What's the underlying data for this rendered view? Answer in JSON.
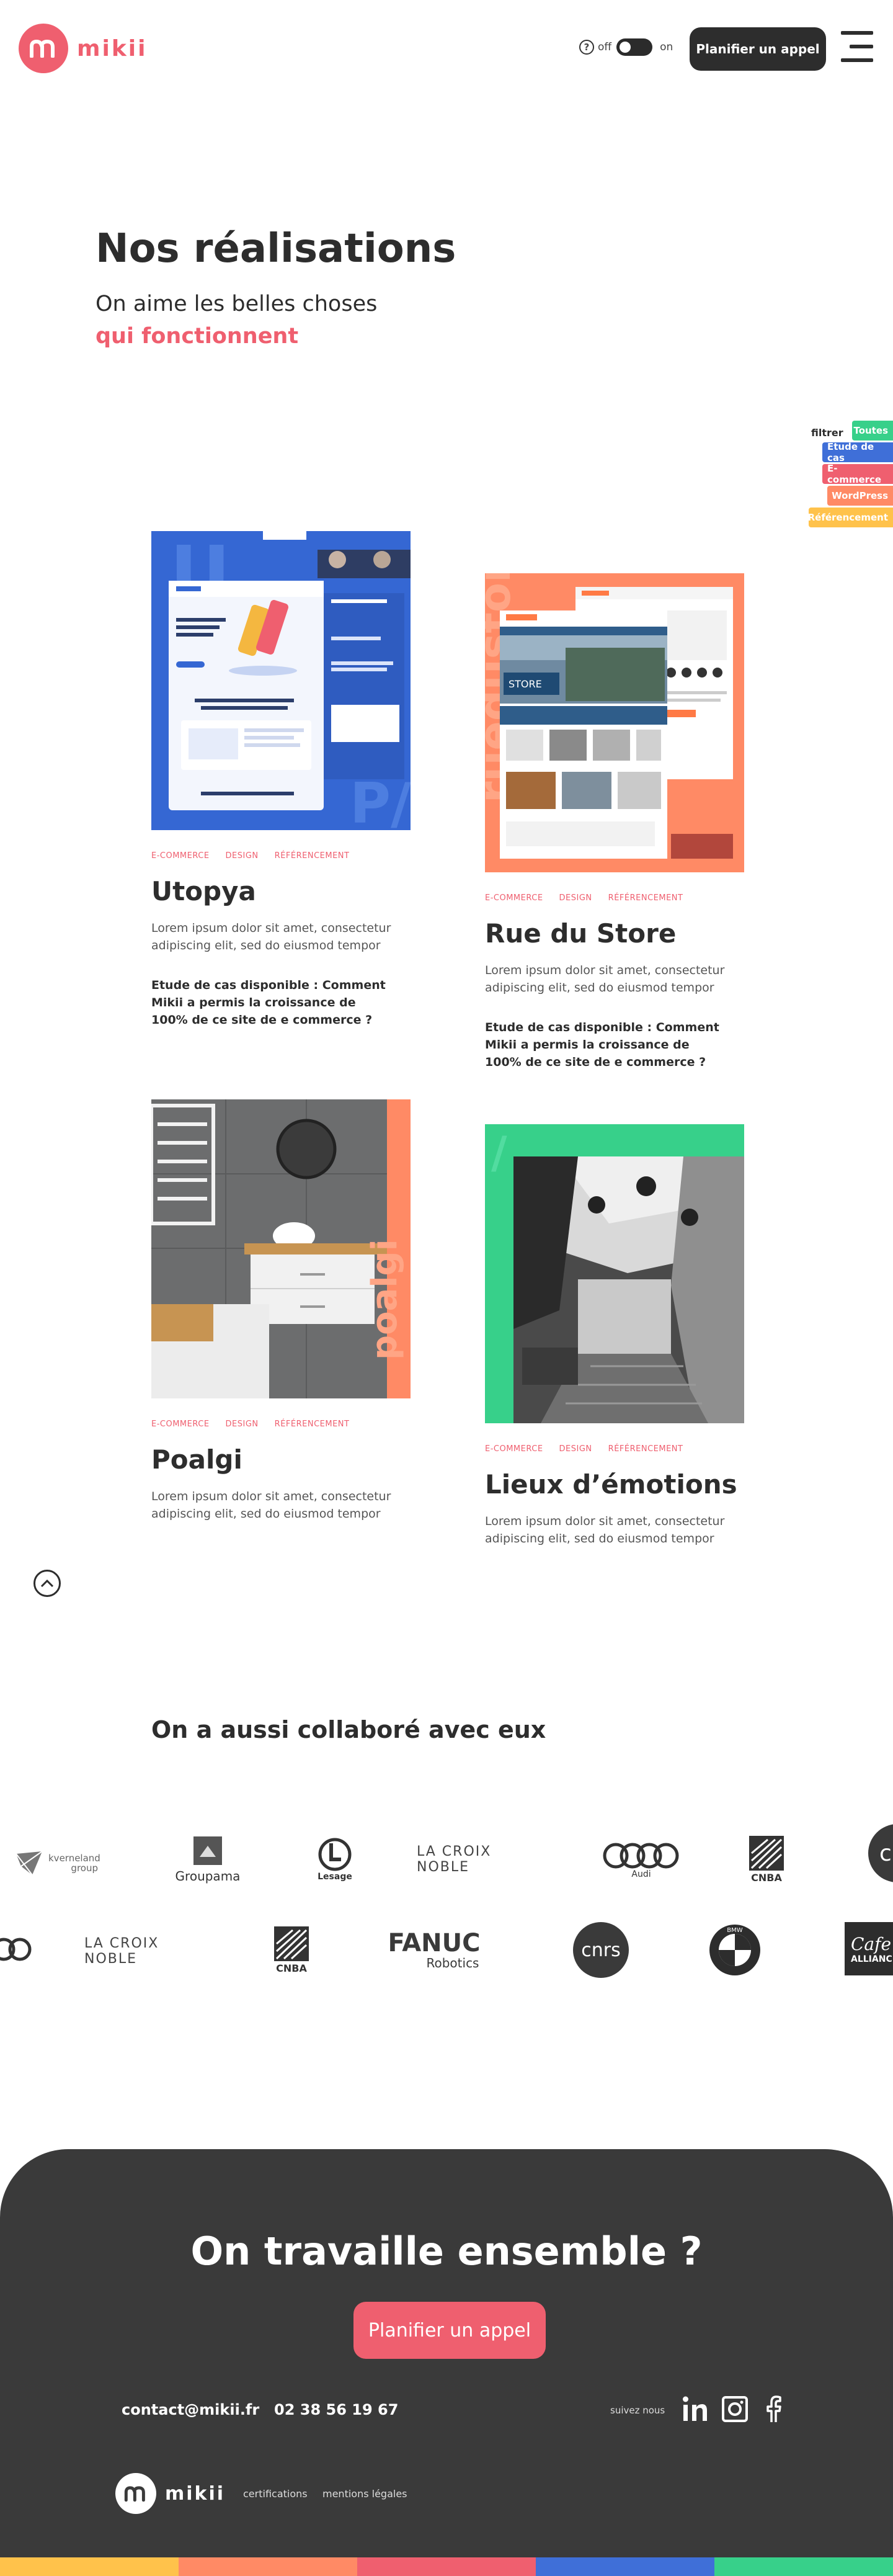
{
  "header": {
    "logo_text": "mikii",
    "toggle_off": "off",
    "toggle_on": "on",
    "cta_label": "Planifier un appel"
  },
  "intro": {
    "title": "Nos réalisations",
    "subtitle_line1": "On aime les belles choses",
    "subtitle_line2": "qui fonctionnent"
  },
  "filter": {
    "label": "filtrer",
    "tags": [
      {
        "label": "Toutes",
        "color": "#37d08a"
      },
      {
        "label": "Étude de cas",
        "color": "#3f6fd8"
      },
      {
        "label": "E-commerce",
        "color": "#ef5f6f"
      },
      {
        "label": "WordPress",
        "color": "#ff8a65"
      },
      {
        "label": "Référencement",
        "color": "#ffc24b"
      }
    ]
  },
  "projects": [
    {
      "title": "Utopya",
      "tags": [
        "E-COMMERCE",
        "DESIGN",
        "RÉFÉRENCEMENT"
      ],
      "desc": "Lorem ipsum dolor sit amet, consectetur adipiscing elit, sed do eiusmod tempor",
      "case": "Etude de cas disponible : Comment Mikii a permis la croissance de 100% de ce site de e commerce ?",
      "accent": "#3f6fd8"
    },
    {
      "title": "Rue du Store",
      "tags": [
        "E-COMMERCE",
        "DESIGN",
        "RÉFÉRENCEMENT"
      ],
      "desc": "Lorem ipsum dolor sit amet, consectetur adipiscing elit, sed do eiusmod tempor",
      "case": "Etude de cas disponible : Comment Mikii a permis la croissance de 100% de ce site de e commerce ?",
      "accent": "#ff8a65",
      "thumb_text": "STORE"
    },
    {
      "title": "Poalgi",
      "tags": [
        "E-COMMERCE",
        "DESIGN",
        "RÉFÉRENCEMENT"
      ],
      "desc": "Lorem ipsum dolor sit amet, consectetur adipiscing elit, sed do eiusmod tempor",
      "accent": "#ff8a65"
    },
    {
      "title": "Lieux d’émotions",
      "tags": [
        "E-COMMERCE",
        "DESIGN",
        "RÉFÉRENCEMENT"
      ],
      "desc": "Lorem ipsum dolor sit amet, consectetur adipiscing elit, sed do eiusmod tempor",
      "accent": "#37d08a"
    }
  ],
  "partners": {
    "title": "On a aussi collaboré avec eux",
    "row1": [
      "kverneland group",
      "Groupama",
      "Lesage",
      "LA CROIX NOBLE",
      "Audi",
      "CNBA",
      "cn"
    ],
    "row2": [
      "LA CROIX NOBLE",
      "CNBA",
      "FANUC",
      "Robotics",
      "cnrs",
      "BMW",
      "Cafe",
      "ALLIANCE"
    ]
  },
  "footer": {
    "title": "On travaille ensemble ?",
    "cta_label": "Planifier un appel",
    "email": "contact@mikii.fr",
    "phone": "02 38 56 19 67",
    "follow_label": "suivez nous",
    "logo_text": "mikii",
    "link_certifications": "certifications",
    "link_legal": "mentions légales",
    "bar_colors": [
      "#ffc24b",
      "#ff8a65",
      "#ef5f6f",
      "#3f6fd8",
      "#37d08a"
    ]
  }
}
